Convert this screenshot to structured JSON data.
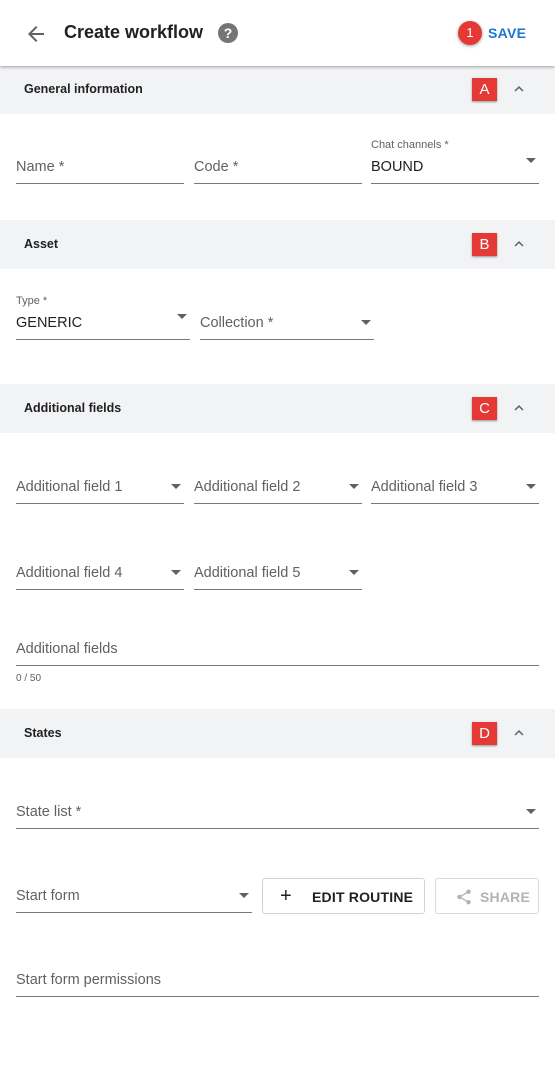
{
  "header": {
    "title": "Create workflow",
    "help_icon": "help-icon",
    "badge": "1",
    "save_label": "SAVE",
    "accent_color": "#1976d2",
    "badge_color": "#e53935"
  },
  "sections": {
    "general": {
      "label": "General information",
      "marker": "A"
    },
    "asset": {
      "label": "Asset",
      "marker": "B"
    },
    "additional": {
      "label": "Additional fields",
      "marker": "C"
    },
    "states": {
      "label": "States",
      "marker": "D"
    }
  },
  "general": {
    "name_placeholder": "Name *",
    "code_placeholder": "Code *",
    "chat_channels_label": "Chat channels *",
    "chat_channels_value": "BOUND"
  },
  "asset": {
    "type_label": "Type *",
    "type_value": "GENERIC",
    "collection_placeholder": "Collection *"
  },
  "additional": {
    "field1": "Additional field 1",
    "field2": "Additional field 2",
    "field3": "Additional field 3",
    "field4": "Additional field 4",
    "field5": "Additional field 5",
    "fields_placeholder": "Additional fields",
    "counter": "0 / 50"
  },
  "states": {
    "state_list_placeholder": "State list *",
    "start_form_placeholder": "Start form",
    "edit_routine_label": "EDIT ROUTINE",
    "share_label": "SHARE",
    "start_form_permissions_placeholder": "Start form permissions"
  }
}
